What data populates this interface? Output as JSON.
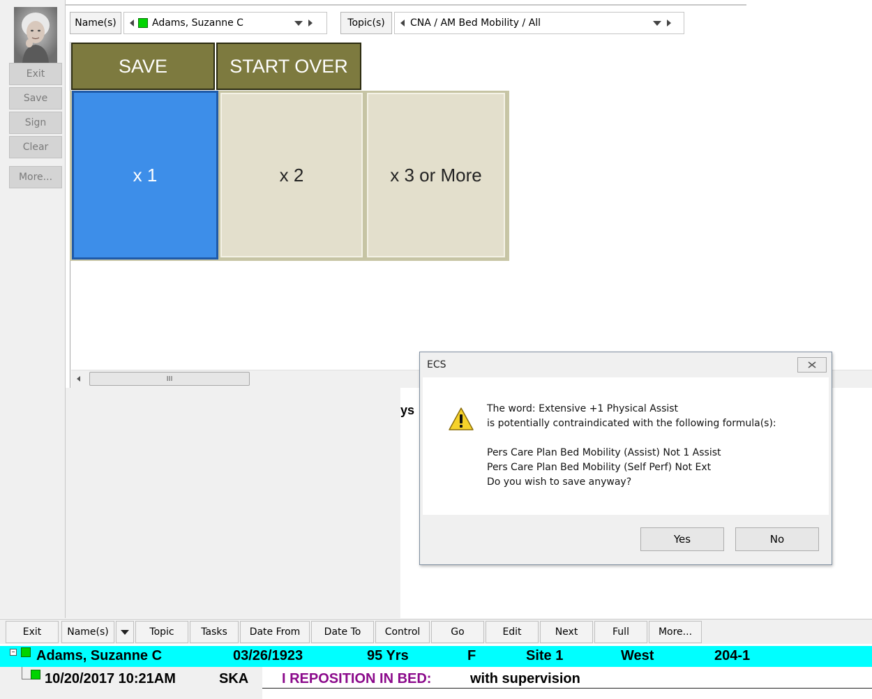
{
  "sidebar": {
    "buttons": [
      "Exit",
      "Save",
      "Sign",
      "Clear",
      "More..."
    ]
  },
  "topbar": {
    "names_label": "Name(s)",
    "name_value": "Adams, Suzanne C",
    "topics_label": "Topic(s)",
    "topic_value": "CNA / AM Bed Mobility / All"
  },
  "actions": {
    "save": "SAVE",
    "start_over": "START OVER"
  },
  "choices": [
    {
      "label": "x 1",
      "selected": true
    },
    {
      "label": "x 2",
      "selected": false
    },
    {
      "label": "x 3 or More",
      "selected": false
    }
  ],
  "scroll_thumb": "III",
  "partial_text": "ys",
  "dialog": {
    "title": "ECS",
    "lines": [
      "The word: Extensive +1 Physical Assist",
      "is potentially contraindicated with the following formula(s):",
      "",
      "Pers Care Plan Bed Mobility (Assist) Not 1 Assist",
      "Pers Care Plan Bed Mobility (Self Perf) Not Ext",
      "Do you wish to save anyway?"
    ],
    "yes": "Yes",
    "no": "No"
  },
  "bottombar": {
    "buttons": [
      "Exit",
      "Name(s)",
      "Topic",
      "Tasks",
      "Date From",
      "Date To",
      "Control",
      "Go",
      "Edit",
      "Next",
      "Full",
      "More..."
    ]
  },
  "resident": {
    "name": "Adams, Suzanne C",
    "dob": "03/26/1923",
    "age": "95 Yrs",
    "sex": "F",
    "site": "Site 1",
    "unit": "West",
    "room": "204-1"
  },
  "entry": {
    "datetime": "10/20/2017  10:21AM",
    "initials": "SKA",
    "task": "I REPOSITION IN BED:",
    "result": "with supervision"
  },
  "colors": {
    "action_button": "#7d7a3f",
    "selected_choice": "#3d8ee9",
    "choice_normal": "#e3dfcc",
    "resident_row": "#00ffff",
    "task_text": "#8b0a8b",
    "status_green": "#00d400"
  }
}
